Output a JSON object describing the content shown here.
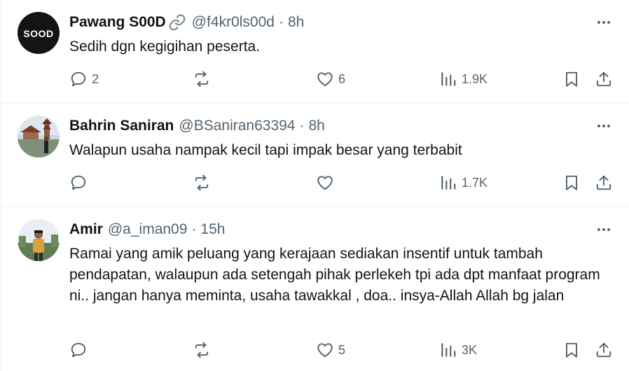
{
  "posts": [
    {
      "name": "Pawang S00D",
      "handle": "@f4kr0ls00d",
      "dot": "·",
      "time": "8h",
      "avatar_text": "SOOD",
      "text": "Sedih dgn kegigihan peserta.",
      "replies": "2",
      "reposts": "",
      "likes": "6",
      "views": "1.9K"
    },
    {
      "name": "Bahrin Saniran",
      "handle": "@BSaniran63394",
      "dot": "·",
      "time": "8h",
      "text": "Walapun usaha nampak kecil tapi impak besar yang terbabit",
      "replies": "",
      "reposts": "",
      "likes": "",
      "views": "1.7K"
    },
    {
      "name": "Amir",
      "handle": "@a_iman09",
      "dot": "·",
      "time": "15h",
      "text": "Ramai yang amik peluang yang kerajaan sediakan insentif untuk tambah pendapatan, walaupun ada setengah pihak perlekeh tpi ada dpt manfaat program ni.. jangan hanya meminta, usaha tawakkal , doa.. insya-Allah Allah bg jalan",
      "replies": "",
      "reposts": "",
      "likes": "5",
      "views": "3K"
    }
  ],
  "icons": {
    "more": "more-horizontal-icon",
    "reply": "reply-bubble-icon",
    "repost": "repost-arrows-icon",
    "like": "heart-icon",
    "views": "analytics-bars-icon",
    "bookmark": "bookmark-icon",
    "share": "share-upload-icon",
    "verified_link": "link-chain-icon"
  },
  "colors": {
    "text": "#0f1419",
    "secondary": "#536471",
    "divider": "#eff3f4"
  }
}
